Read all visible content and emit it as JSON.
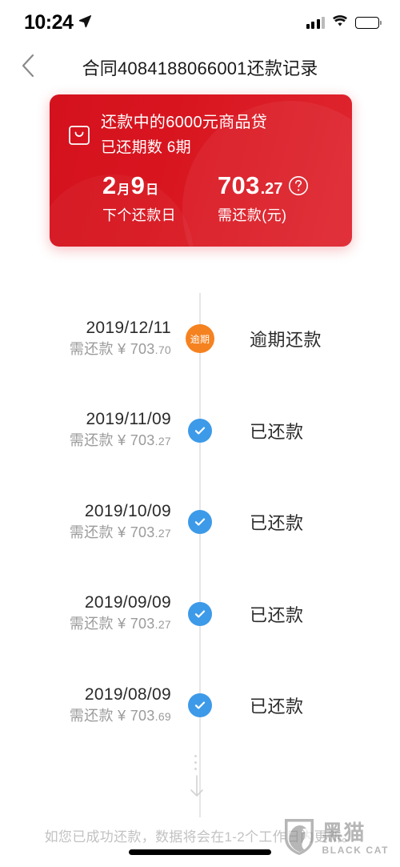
{
  "status_bar": {
    "time": "10:24",
    "location_icon": "location-arrow-icon",
    "signal_icon": "cellular-signal-icon",
    "wifi_icon": "wifi-icon",
    "battery_icon": "battery-full-icon"
  },
  "nav": {
    "back_icon": "chevron-left-icon",
    "title": "合同4084188066001还款记录"
  },
  "card": {
    "bag_icon": "shopping-bag-icon",
    "title": "还款中的6000元商品贷",
    "subtitle": "已还期数 6期",
    "accent_color": "#d8151f",
    "next_date": {
      "month": "2",
      "month_unit": "月",
      "day": "9",
      "day_unit": "日",
      "label": "下个还款日"
    },
    "amount_due": {
      "int": "703",
      "dec": ".27",
      "help_icon": "question-circle-icon",
      "label": "需还款(元)"
    }
  },
  "timeline": {
    "rows": [
      {
        "date": "2019/12/11",
        "amount_prefix": "需还款 ¥ ",
        "amount_int": "703",
        "amount_dec": ".70",
        "status": "逾期还款",
        "badge_type": "overdue",
        "badge_text": "逾期",
        "badge_color": "#f58220",
        "badge_icon": "overdue-badge-icon"
      },
      {
        "date": "2019/11/09",
        "amount_prefix": "需还款 ¥ ",
        "amount_int": "703",
        "amount_dec": ".27",
        "status": "已还款",
        "badge_type": "paid",
        "badge_text": "",
        "badge_color": "#3d9ae8",
        "badge_icon": "check-circle-icon"
      },
      {
        "date": "2019/10/09",
        "amount_prefix": "需还款 ¥ ",
        "amount_int": "703",
        "amount_dec": ".27",
        "status": "已还款",
        "badge_type": "paid",
        "badge_text": "",
        "badge_color": "#3d9ae8",
        "badge_icon": "check-circle-icon"
      },
      {
        "date": "2019/09/09",
        "amount_prefix": "需还款 ¥ ",
        "amount_int": "703",
        "amount_dec": ".27",
        "status": "已还款",
        "badge_type": "paid",
        "badge_text": "",
        "badge_color": "#3d9ae8",
        "badge_icon": "check-circle-icon"
      },
      {
        "date": "2019/08/09",
        "amount_prefix": "需还款 ¥ ",
        "amount_int": "703",
        "amount_dec": ".69",
        "status": "已还款",
        "badge_type": "paid",
        "badge_text": "",
        "badge_color": "#3d9ae8",
        "badge_icon": "check-circle-icon"
      }
    ],
    "more_icon": "arrow-down-icon"
  },
  "footer": {
    "note": "如您已成功还款，数据将会在1-2个工作日内更新。"
  },
  "watermark": {
    "logo_icon": "black-cat-shield-icon",
    "name_cn": "黑猫",
    "name_en": "BLACK CAT"
  }
}
